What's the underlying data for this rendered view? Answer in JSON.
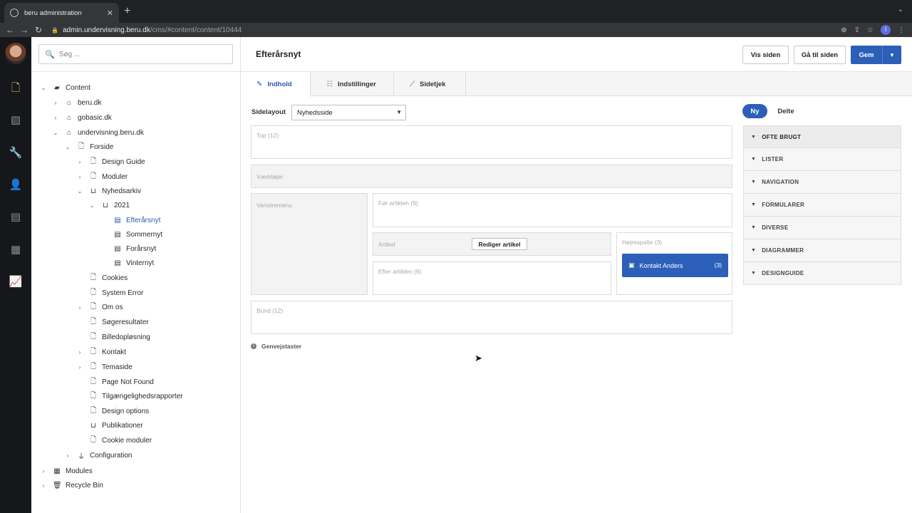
{
  "browser": {
    "tab_title": "beru administration",
    "tab_close": "✕",
    "new_tab": "+",
    "url_host": "admin.undervisning.beru.dk",
    "url_path": "/cms/#content/content/10444",
    "profile_initial": "I"
  },
  "sidebar": {
    "search_placeholder": "Søg ...",
    "tree": [
      {
        "label": "Content",
        "level": 0,
        "chevron": "down",
        "icon": "folder-icon"
      },
      {
        "label": "beru.dk",
        "level": 1,
        "chevron": "right",
        "icon": "home-icon"
      },
      {
        "label": "gobasic.dk",
        "level": 1,
        "chevron": "right",
        "icon": "home-icon"
      },
      {
        "label": "undervisning.beru.dk",
        "level": 1,
        "chevron": "down",
        "icon": "home-icon"
      },
      {
        "label": "Forside",
        "level": 2,
        "chevron": "down",
        "icon": "page-icon"
      },
      {
        "label": "Design Guide",
        "level": 3,
        "chevron": "right",
        "icon": "page-icon"
      },
      {
        "label": "Moduler",
        "level": 3,
        "chevron": "right",
        "icon": "page-icon"
      },
      {
        "label": "Nyhedsarkiv",
        "level": 3,
        "chevron": "down",
        "icon": "inbox-icon"
      },
      {
        "label": "2021",
        "level": 4,
        "chevron": "down",
        "icon": "inbox-icon"
      },
      {
        "label": "Efterårsnyt",
        "level": 5,
        "chevron": "none",
        "icon": "newspaper-icon",
        "selected": true
      },
      {
        "label": "Sommernyt",
        "level": 5,
        "chevron": "none",
        "icon": "newspaper-icon"
      },
      {
        "label": "Forårsnyt",
        "level": 5,
        "chevron": "none",
        "icon": "newspaper-icon"
      },
      {
        "label": "Vinternyt",
        "level": 5,
        "chevron": "none",
        "icon": "newspaper-icon"
      },
      {
        "label": "Cookies",
        "level": 3,
        "chevron": "none",
        "icon": "page-icon"
      },
      {
        "label": "System Error",
        "level": 3,
        "chevron": "none",
        "icon": "page-icon"
      },
      {
        "label": "Om os",
        "level": 3,
        "chevron": "right",
        "icon": "page-icon"
      },
      {
        "label": "Søgeresultater",
        "level": 3,
        "chevron": "none",
        "icon": "page-icon"
      },
      {
        "label": "Billedopløsning",
        "level": 3,
        "chevron": "none",
        "icon": "page-icon"
      },
      {
        "label": "Kontakt",
        "level": 3,
        "chevron": "right",
        "icon": "page-icon"
      },
      {
        "label": "Temaside",
        "level": 3,
        "chevron": "right",
        "icon": "page-icon"
      },
      {
        "label": "Page Not Found",
        "level": 3,
        "chevron": "none",
        "icon": "page-icon"
      },
      {
        "label": "Tilgængelighedsrapporter",
        "level": 3,
        "chevron": "none",
        "icon": "page-icon"
      },
      {
        "label": "Design options",
        "level": 3,
        "chevron": "none",
        "icon": "page-icon"
      },
      {
        "label": "Publikationer",
        "level": 3,
        "chevron": "none",
        "icon": "inbox-icon"
      },
      {
        "label": "Cookie moduler",
        "level": 3,
        "chevron": "none",
        "icon": "page-icon"
      },
      {
        "label": "Configuration",
        "level": 2,
        "chevron": "right",
        "icon": "plug-icon"
      },
      {
        "label": "Modules",
        "level": 0,
        "chevron": "right",
        "icon": "modules-icon"
      },
      {
        "label": "Recycle Bin",
        "level": 0,
        "chevron": "right",
        "icon": "trash-icon"
      }
    ]
  },
  "header": {
    "title": "Efterårsnyt",
    "vis_siden": "Vis siden",
    "ga_til_siden": "Gå til siden",
    "gem": "Gem"
  },
  "tabs": {
    "indhold": "Indhold",
    "indstillinger": "Indstillinger",
    "sidetjek": "Sidetjek"
  },
  "layout": {
    "label": "Sidelayout",
    "selected": "Nyhedsside",
    "zones": {
      "top": "Top (12)",
      "vaerktojer": "Værktøjer",
      "venstremenu": "Venstremenu",
      "for_artiklen": "Før artiklen (9)",
      "artikel": "Artikel",
      "rediger_artikel": "Rediger artikel",
      "hojrespalte": "Højrespalte (3)",
      "efter_artiklen": "Efter artiklen (6)",
      "bund": "Bund (12)"
    },
    "widget": {
      "label": "Kontakt Anders",
      "count": "(3)"
    },
    "shortcut": "Genvejstaster"
  },
  "panel": {
    "ny": "Ny",
    "delte": "Delte",
    "categories": [
      "OFTE BRUGT",
      "LISTER",
      "NAVIGATION",
      "FORMULARER",
      "DIVERSE",
      "DIAGRAMMER",
      "DESIGNGUIDE"
    ]
  },
  "colors": {
    "accent": "#2b5fb8",
    "rail_bg": "#16171a",
    "rail_active": "#e8d87a"
  }
}
